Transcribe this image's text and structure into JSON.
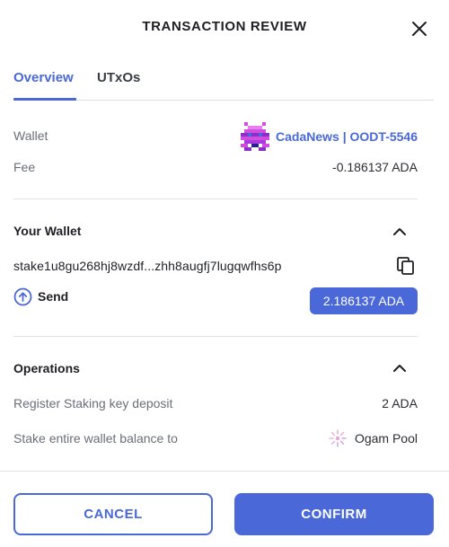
{
  "header": {
    "title": "TRANSACTION REVIEW"
  },
  "tabs": [
    {
      "label": "Overview",
      "active": true
    },
    {
      "label": "UTxOs",
      "active": false
    }
  ],
  "summary": {
    "wallet_label": "Wallet",
    "wallet_name": "CadaNews | OODT-5546",
    "fee_label": "Fee",
    "fee_value": "-0.186137 ADA"
  },
  "your_wallet": {
    "title": "Your Wallet",
    "address": "stake1u8gu268hj8wzdf...zhh8augfj7lugqwfhs6p",
    "send_label": "Send",
    "send_amount": "2.186137 ADA"
  },
  "operations": {
    "title": "Operations",
    "items": [
      {
        "label": "Register Staking key deposit",
        "value": "2 ADA"
      },
      {
        "label": "Stake entire wallet balance to",
        "value": "Ogam Pool"
      }
    ]
  },
  "footer": {
    "cancel_label": "CANCEL",
    "confirm_label": "CONFIRM"
  },
  "colors": {
    "accent": "#4a68d8",
    "text": "#1e1f24",
    "muted": "#6b6e78",
    "divider": "#e2e3e7"
  },
  "icons": [
    "close-icon",
    "wallet-avatar-icon",
    "chevron-up-icon",
    "copy-icon",
    "arrow-up-circle-icon",
    "pool-logo-icon"
  ]
}
